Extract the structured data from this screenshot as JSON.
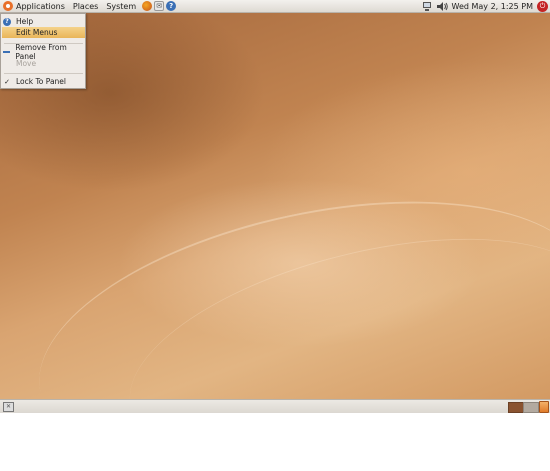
{
  "top_panel": {
    "menus": [
      "Applications",
      "Places",
      "System"
    ],
    "launchers": [
      {
        "icon": "firefox-icon",
        "glyph": ""
      },
      {
        "icon": "mail-icon",
        "glyph": "✉"
      },
      {
        "icon": "help-icon",
        "glyph": "?"
      }
    ],
    "tray": {
      "network_icon": "network-icon",
      "volume_icon": "volume-icon",
      "clock": "Wed May  2,  1:25 PM",
      "power_icon": "power-icon"
    }
  },
  "context_menu": {
    "items": [
      {
        "label": "Help",
        "icon": "help-icon",
        "state": "normal"
      },
      {
        "label": "Edit Menus",
        "icon": "",
        "state": "active"
      },
      {
        "label": "Remove From Panel",
        "icon": "remove-icon",
        "state": "normal"
      },
      {
        "label": "Move",
        "icon": "",
        "state": "disabled"
      },
      {
        "label": "Lock To Panel",
        "icon": "check-icon",
        "state": "normal"
      }
    ]
  },
  "bottom_panel": {
    "show_desktop_icon": "show-desktop-icon",
    "workspaces": [
      "workspace-1",
      "workspace-2"
    ],
    "trash_icon": "trash-icon"
  },
  "colors": {
    "wallpaper_base": "#c08350",
    "menu_highlight": "#f0c070",
    "panel_bg": "#ebe8e3"
  }
}
